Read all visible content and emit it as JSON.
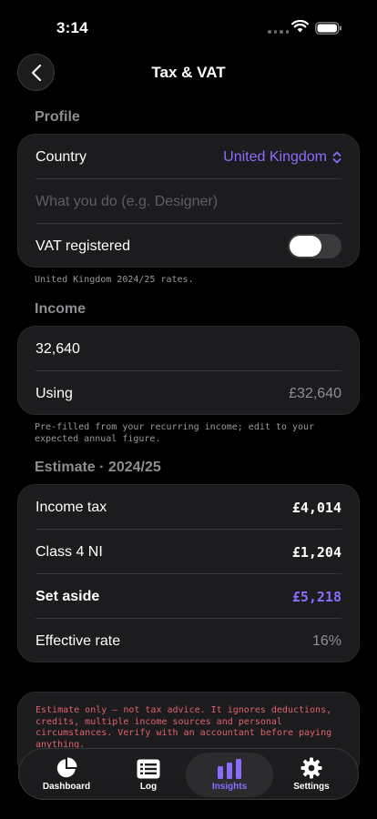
{
  "status_bar": {
    "time": "3:14"
  },
  "nav": {
    "title": "Tax & VAT"
  },
  "profile": {
    "header": "Profile",
    "country_label": "Country",
    "country_value": "United Kingdom",
    "occupation_placeholder": "What you do (e.g. Designer)",
    "vat_label": "VAT registered",
    "vat_on": false,
    "footnote": "United Kingdom 2024/25 rates."
  },
  "income": {
    "header": "Income",
    "value": "32,640",
    "using_label": "Using",
    "using_value": "£32,640",
    "footnote": "Pre-filled from your recurring income; edit to your expected annual figure."
  },
  "estimate": {
    "header": "Estimate · 2024/25",
    "rows": [
      {
        "label": "Income tax",
        "value": "£4,014"
      },
      {
        "label": "Class 4 NI",
        "value": "£1,204"
      },
      {
        "label": "Set aside",
        "value": "£5,218"
      },
      {
        "label": "Effective rate",
        "value": "16%"
      }
    ]
  },
  "disclaimer": "Estimate only — not tax advice. It ignores deductions, credits, multiple income sources and personal circumstances. Verify with an accountant before paying anything.",
  "tabs": [
    {
      "label": "Dashboard",
      "icon": "pie-chart-icon",
      "active": false
    },
    {
      "label": "Log",
      "icon": "list-icon",
      "active": false
    },
    {
      "label": "Insights",
      "icon": "bar-chart-icon",
      "active": true
    },
    {
      "label": "Settings",
      "icon": "gear-icon",
      "active": false
    }
  ],
  "colors": {
    "accent": "#8b6cff",
    "background": "#000000",
    "card": "#1c1c1e",
    "warning": "#e0626b"
  }
}
